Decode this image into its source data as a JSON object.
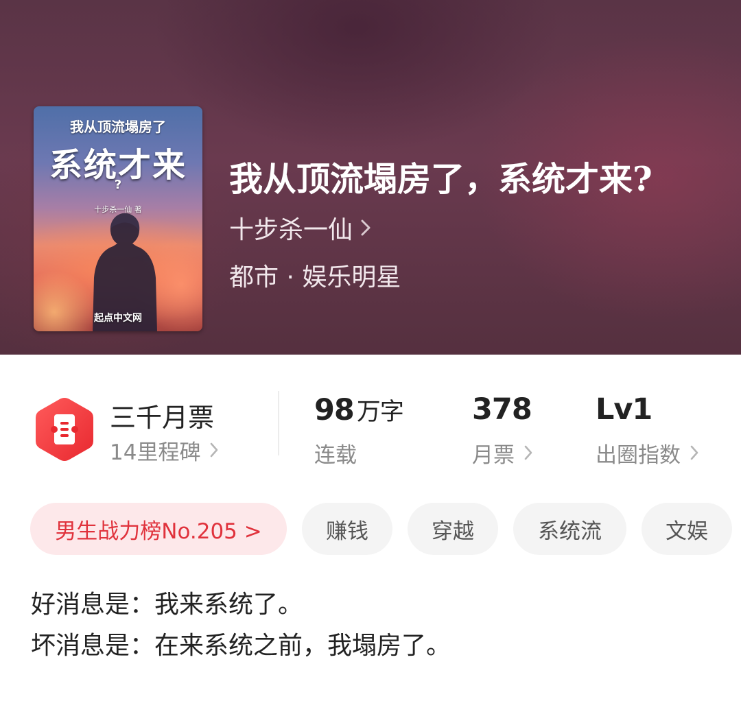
{
  "hero": {
    "cover": {
      "top_text": "我从顶流塌房了",
      "big_text": "系统才来",
      "question_mark": "?",
      "author_text": "十步杀一仙 著",
      "publisher": "起点中文网"
    },
    "title": "我从顶流塌房了，系统才来?",
    "author": "十步杀一仙",
    "author_chevron": "›",
    "genre": "都市 · 娱乐明星"
  },
  "stats": {
    "badge_icon": "ticket-hexagon-icon",
    "monthly_ticket_title": "三千月票",
    "milestones": "14里程碑",
    "word_count": "98",
    "word_unit": "万字",
    "status": "连载",
    "monthly_tickets": "378",
    "monthly_tickets_label": "月票",
    "level": "Lv1",
    "index_label": "出圈指数",
    "chevron": "›"
  },
  "tags": {
    "rank": "男生战力榜No.205 >",
    "items": [
      "赚钱",
      "穿越",
      "系统流",
      "文娱"
    ]
  },
  "synopsis": {
    "line1": "好消息是：我来系统了。",
    "line2": "坏消息是：在来系统之前，我塌房了。"
  },
  "colors": {
    "accent_red": "#e0323c",
    "rank_bg": "#fde8ea",
    "tag_bg": "#f4f4f4",
    "hero_bg": "#5e3547"
  }
}
